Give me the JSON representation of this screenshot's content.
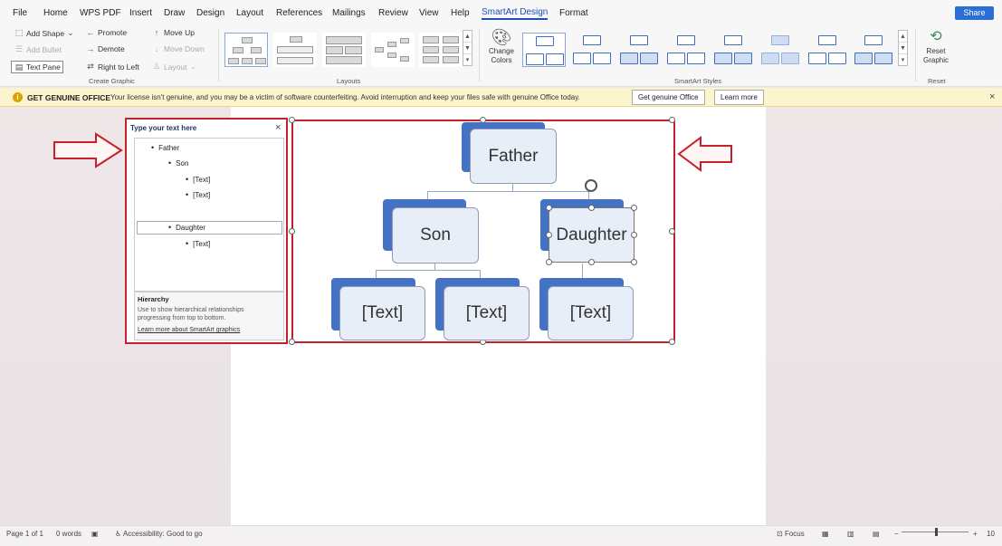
{
  "menu": {
    "items": [
      "File",
      "Home",
      "WPS PDF",
      "Insert",
      "Draw",
      "Design",
      "Layout",
      "References",
      "Mailings",
      "Review",
      "View",
      "Help",
      "SmartArt Design",
      "Format"
    ],
    "active": "SmartArt Design",
    "share": "Share"
  },
  "ribbon": {
    "create_graphic": {
      "add_shape": "Add Shape",
      "add_bullet": "Add Bullet",
      "text_pane": "Text Pane",
      "promote": "Promote",
      "demote": "Demote",
      "right_to_left": "Right to Left",
      "move_up": "Move Up",
      "move_down": "Move Down",
      "layout": "Layout",
      "label": "Create Graphic"
    },
    "layouts_label": "Layouts",
    "change_colors": "Change Colors",
    "styles_label": "SmartArt Styles",
    "reset_graphic": "Reset Graphic",
    "reset_label": "Reset"
  },
  "notification": {
    "title": "GET GENUINE OFFICE",
    "message": "Your license isn't genuine, and you may be a victim of software counterfeiting. Avoid interruption and keep your files safe with genuine Office today.",
    "button_primary": "Get genuine Office",
    "button_secondary": "Learn more"
  },
  "text_pane": {
    "title": "Type your text here",
    "items": [
      {
        "text": "Father",
        "level": 1
      },
      {
        "text": "Son",
        "level": 2
      },
      {
        "text": "[Text]",
        "level": 3
      },
      {
        "text": "[Text]",
        "level": 3
      },
      {
        "text": "Daughter",
        "level": 2
      },
      {
        "text": "[Text]",
        "level": 3
      }
    ],
    "info_title": "Hierarchy",
    "info_desc": "Use to show hierarchical relationships progressing from top to bottom.",
    "info_link": "Learn more about SmartArt graphics"
  },
  "smartart": {
    "father": "Father",
    "son": "Son",
    "daughter": "Daughter",
    "child1": "[Text]",
    "child2": "[Text]",
    "child3": "[Text]"
  },
  "status": {
    "page": "Page 1 of 1",
    "words": "0 words",
    "accessibility": "Accessibility: Good to go",
    "focus": "Focus",
    "zoom": "10"
  },
  "colors": {
    "accent": "#4472c4",
    "highlight": "#c8202a",
    "notify_bg": "#fcf4cd"
  }
}
